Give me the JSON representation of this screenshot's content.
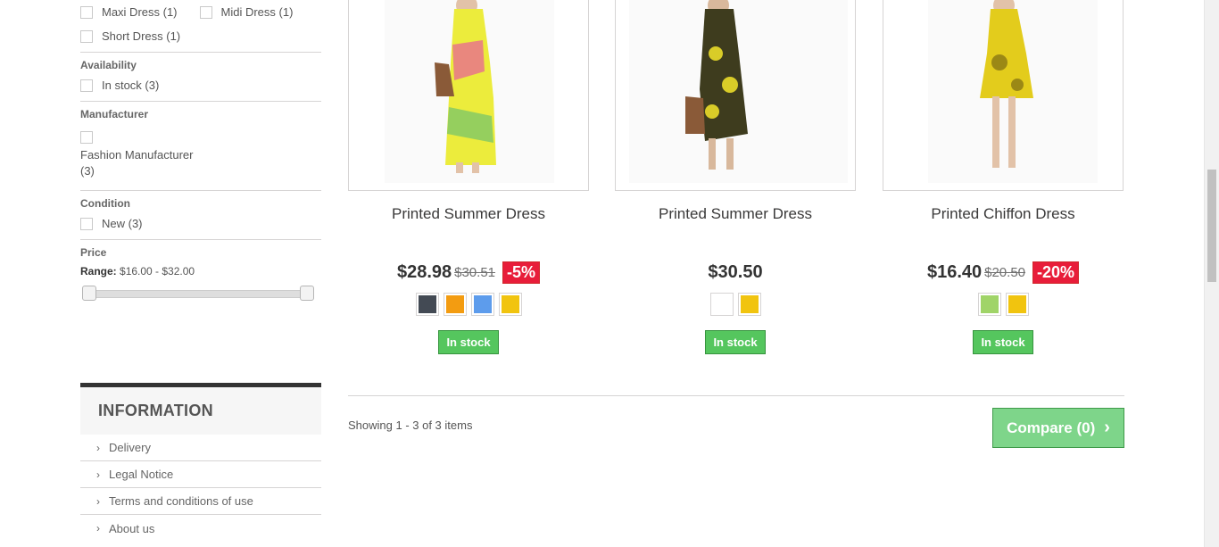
{
  "filters": {
    "styles": [
      {
        "label": "Maxi Dress (1)"
      },
      {
        "label": "Midi Dress (1)"
      },
      {
        "label": "Short Dress (1)"
      }
    ],
    "availability": {
      "title": "Availability",
      "options": [
        {
          "label": "In stock (3)"
        }
      ]
    },
    "manufacturer": {
      "title": "Manufacturer",
      "options": [
        {
          "label": "Fashion Manufacturer (3)"
        }
      ]
    },
    "condition": {
      "title": "Condition",
      "options": [
        {
          "label": "New (3)"
        }
      ]
    },
    "price": {
      "title": "Price",
      "range_label": "Range:",
      "range_value": "$16.00 - $32.00",
      "min": 16,
      "max": 32
    }
  },
  "information": {
    "title": "INFORMATION",
    "items": [
      {
        "label": "Delivery"
      },
      {
        "label": "Legal Notice"
      },
      {
        "label": "Terms and conditions of use"
      },
      {
        "label": "About us"
      }
    ]
  },
  "products": [
    {
      "name": "Printed Summer Dress",
      "price": "$28.98",
      "old_price": "$30.51",
      "reduction": "-5%",
      "colors": [
        "#434a54",
        "#f39c11",
        "#5d9cec",
        "#f1c40f"
      ],
      "stock": "In stock"
    },
    {
      "name": "Printed Summer Dress",
      "price": "$30.50",
      "old_price": "",
      "reduction": "",
      "colors": [
        "#ffffff",
        "#f1c40f"
      ],
      "stock": "In stock"
    },
    {
      "name": "Printed Chiffon Dress",
      "price": "$16.40",
      "old_price": "$20.50",
      "reduction": "-20%",
      "colors": [
        "#a0d468",
        "#f1c40f"
      ],
      "stock": "In stock"
    }
  ],
  "listing": {
    "showing": "Showing 1 - 3 of 3 items",
    "compare_label": "Compare (0)"
  }
}
